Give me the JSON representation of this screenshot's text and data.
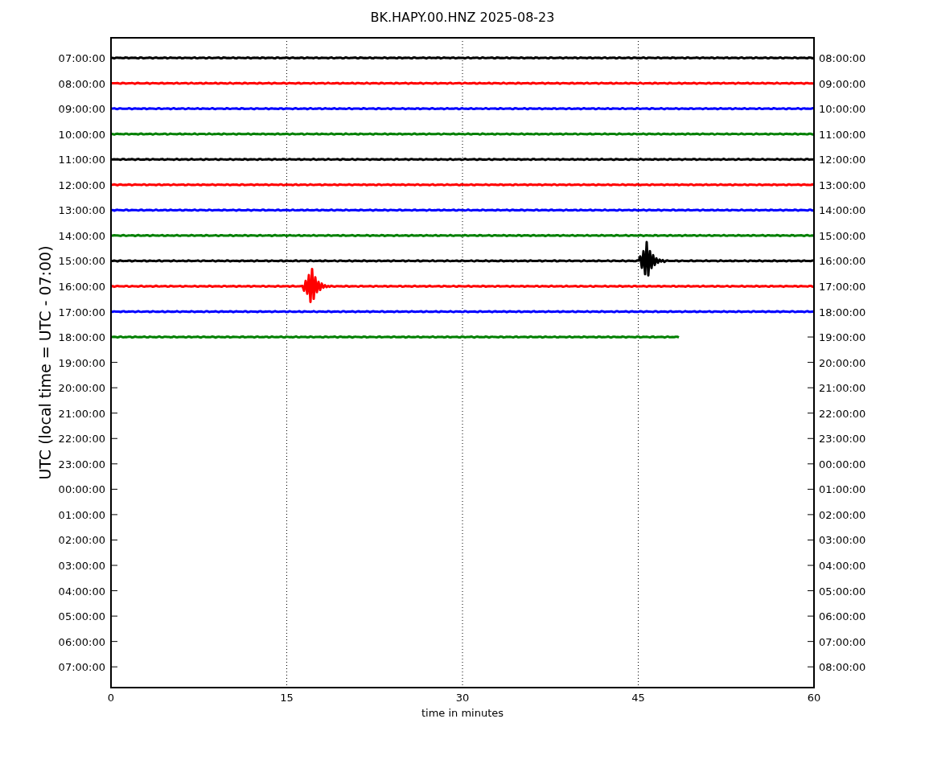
{
  "plot": {
    "title": "BK.HAPY.00.HNZ 2025-08-23",
    "xlabel": "time in minutes",
    "ylabel": "UTC (local time = UTC - 07:00)",
    "xtick_labels": [
      "0",
      "15",
      "30",
      "45",
      "60"
    ],
    "left_ytick_labels": [
      "07:00:00",
      "08:00:00",
      "09:00:00",
      "10:00:00",
      "11:00:00",
      "12:00:00",
      "13:00:00",
      "14:00:00",
      "15:00:00",
      "16:00:00",
      "17:00:00",
      "18:00:00",
      "19:00:00",
      "20:00:00",
      "21:00:00",
      "22:00:00",
      "23:00:00",
      "00:00:00",
      "01:00:00",
      "02:00:00",
      "03:00:00",
      "04:00:00",
      "05:00:00",
      "06:00:00",
      "07:00:00"
    ],
    "right_ytick_labels": [
      "08:00:00",
      "09:00:00",
      "10:00:00",
      "11:00:00",
      "12:00:00",
      "13:00:00",
      "14:00:00",
      "15:00:00",
      "16:00:00",
      "17:00:00",
      "18:00:00",
      "19:00:00",
      "20:00:00",
      "21:00:00",
      "22:00:00",
      "23:00:00",
      "00:00:00",
      "01:00:00",
      "02:00:00",
      "03:00:00",
      "04:00:00",
      "05:00:00",
      "06:00:00",
      "07:00:00",
      "08:00:00"
    ],
    "traces": [
      {
        "kind": "quiet",
        "color": "#000000"
      },
      {
        "kind": "quiet",
        "color": "#ff0000"
      },
      {
        "kind": "quiet",
        "color": "#0000ff"
      },
      {
        "kind": "quiet",
        "color": "#008000"
      },
      {
        "kind": "quiet",
        "color": "#000000"
      },
      {
        "kind": "quiet",
        "color": "#ff0000"
      },
      {
        "kind": "quiet",
        "color": "#0000ff"
      },
      {
        "kind": "quiet",
        "color": "#008000"
      },
      {
        "kind": "late-event",
        "color": "#000000"
      },
      {
        "kind": "early-event",
        "color": "#ff0000"
      },
      {
        "kind": "quiet",
        "color": "#0000ff"
      },
      {
        "kind": "partial",
        "color": "#008000"
      }
    ]
  }
}
